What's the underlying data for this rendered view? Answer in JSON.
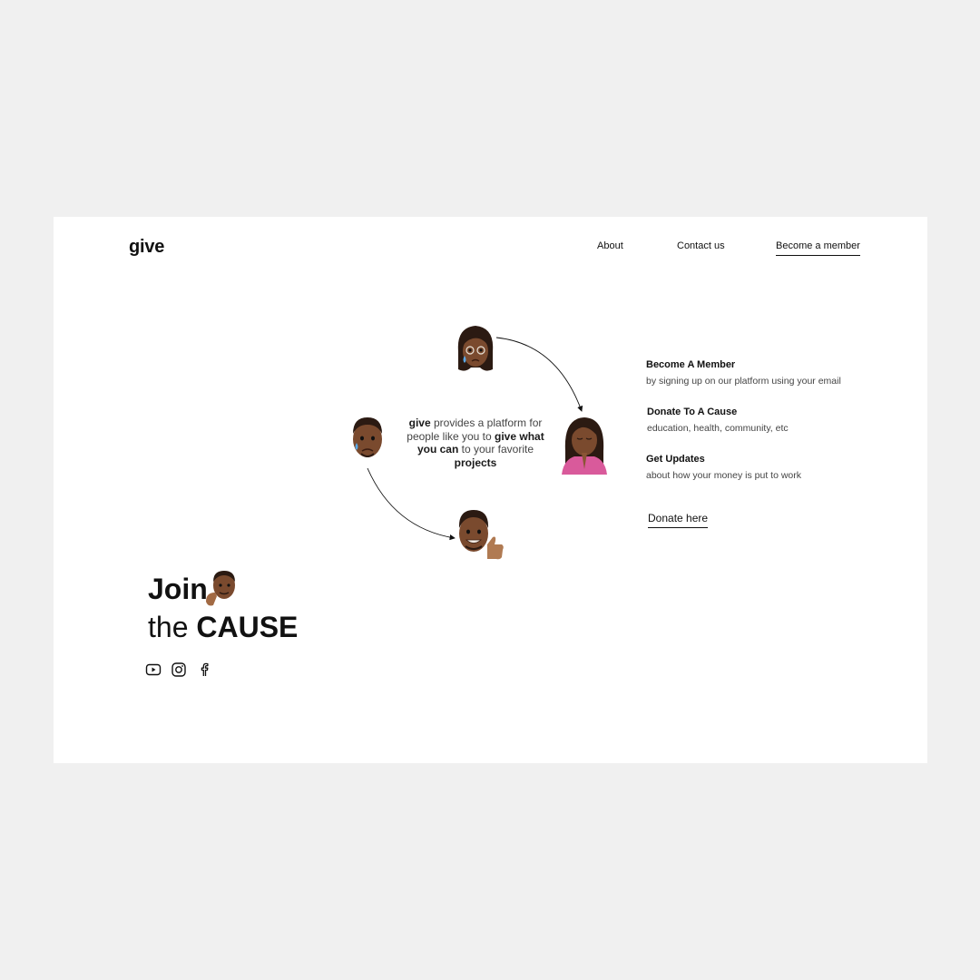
{
  "brand": {
    "logo": "give"
  },
  "nav": {
    "about": "About",
    "contact": "Contact us",
    "member": "Become a member"
  },
  "platform": {
    "b1": "give",
    "t1": " provides a platform for people like you to ",
    "b2": "give what you can",
    "t2": " to your favorite ",
    "b3": "projects"
  },
  "features": [
    {
      "title": "Become A Member",
      "desc": "by signing up on our platform using your email"
    },
    {
      "title": "Donate To A Cause",
      "desc": "education, health, community, etc"
    },
    {
      "title": "Get Updates",
      "desc": "about how your money is put to work"
    }
  ],
  "donate_link": "Donate here",
  "hero": {
    "word1": "Join",
    "word2": "the",
    "word3": "CAUSE"
  },
  "social_icons": [
    "youtube-icon",
    "instagram-icon",
    "facebook-icon"
  ],
  "colors": {
    "page_bg": "#f0f0f0",
    "card_bg": "#ffffff",
    "text": "#111111",
    "muted": "#444444",
    "skin": "#7a4a2e"
  }
}
